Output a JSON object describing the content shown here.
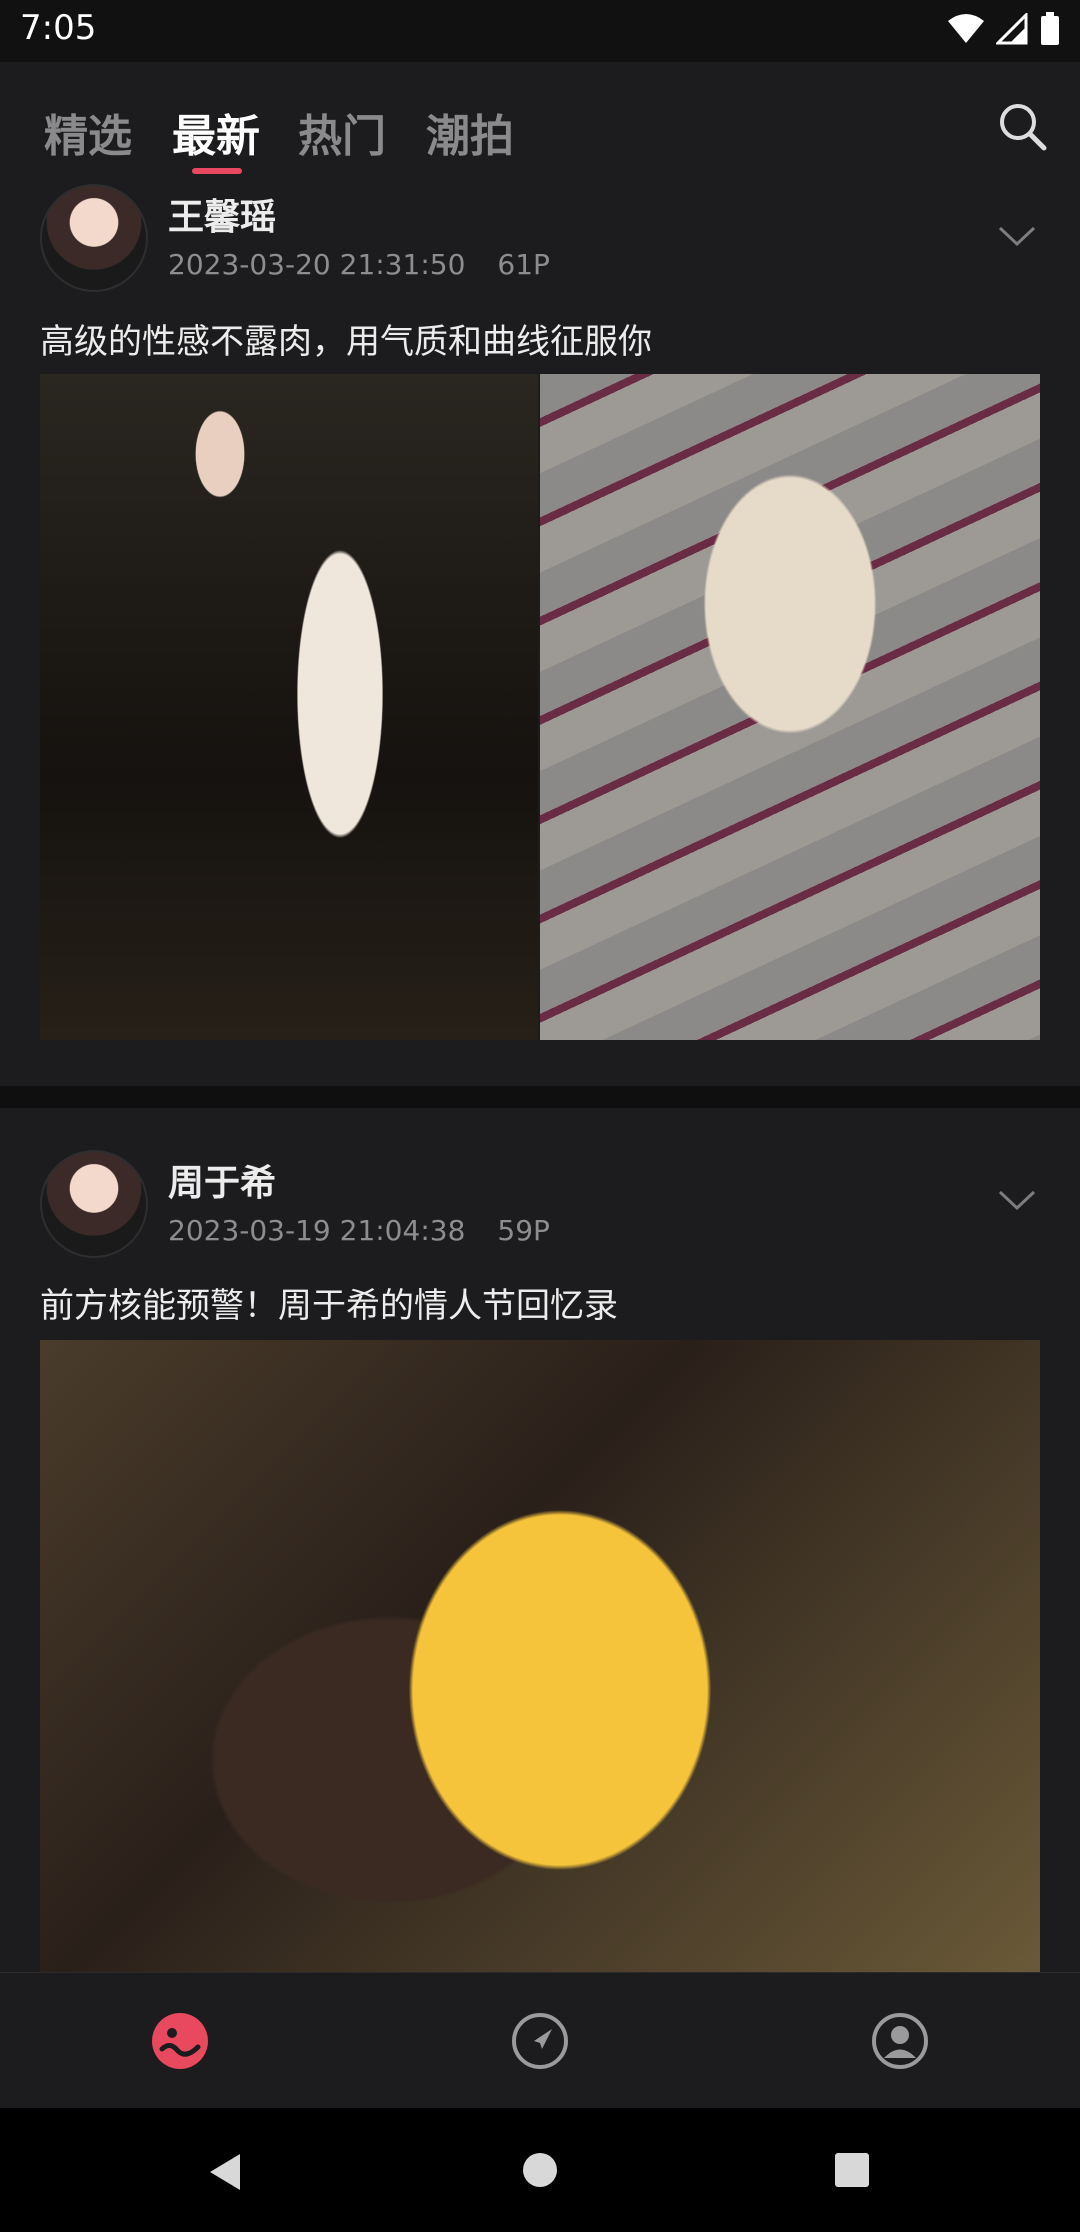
{
  "status_bar": {
    "time": "7:05",
    "icons": [
      "wifi-icon",
      "signal-icon",
      "battery-icon"
    ]
  },
  "tabs": [
    {
      "label": "精选",
      "active": false
    },
    {
      "label": "最新",
      "active": true
    },
    {
      "label": "热门",
      "active": false
    },
    {
      "label": "潮拍",
      "active": false
    }
  ],
  "accent_color": "#e8495e",
  "posts": [
    {
      "author": "王馨瑶",
      "date": "2023-03-20 21:31:50",
      "count": "61P",
      "caption": "高级的性感不露肉，用气质和曲线征服你"
    },
    {
      "author": "周于希",
      "date": "2023-03-19 21:04:38",
      "count": "59P",
      "caption": "前方核能预警！周于希的情人节回忆录"
    }
  ],
  "bottom_nav": [
    {
      "icon": "home-face-icon",
      "active": true
    },
    {
      "icon": "compass-icon",
      "active": false
    },
    {
      "icon": "profile-icon",
      "active": false
    }
  ],
  "system_nav": [
    "back-icon",
    "home-icon",
    "recents-icon"
  ]
}
